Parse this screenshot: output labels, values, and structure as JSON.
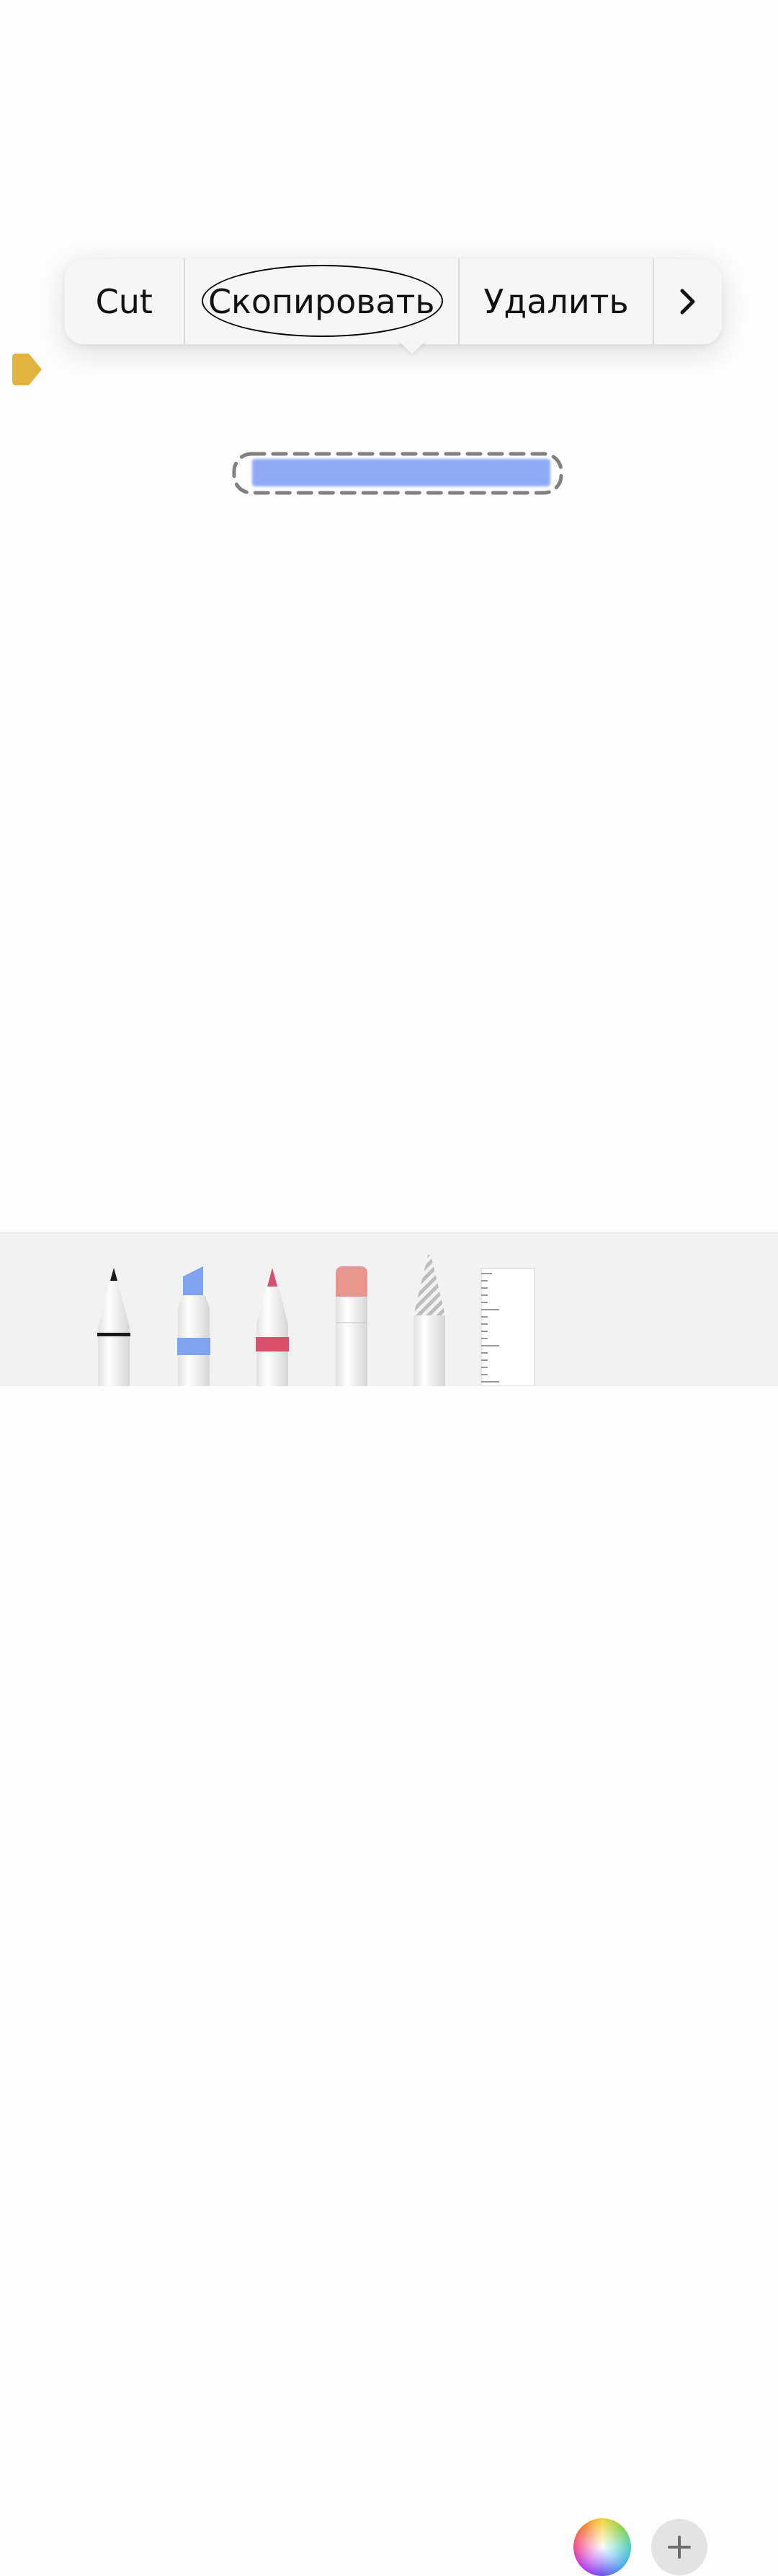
{
  "context_menu": {
    "cut_label": "Cut",
    "copy_label": "Скопировать",
    "delete_label": "Удалить",
    "more_icon": "chevron-right-icon"
  },
  "toolbar": {
    "tools": [
      {
        "name": "pen",
        "icon": "pen-icon",
        "color": "#1a1a1a"
      },
      {
        "name": "marker",
        "icon": "marker-icon",
        "color": "#7fa3ee"
      },
      {
        "name": "pencil",
        "icon": "pencil-icon",
        "color": "#d9506e"
      },
      {
        "name": "eraser",
        "icon": "eraser-icon",
        "color": "#e9958f"
      },
      {
        "name": "lasso",
        "icon": "lasso-icon",
        "color": "#cfcfcf"
      },
      {
        "name": "ruler",
        "icon": "ruler-icon",
        "color": "#ffffff"
      }
    ],
    "color_picker_icon": "color-wheel-icon",
    "add_icon": "plus-icon"
  },
  "canvas": {
    "stroke_color": "#90acf7",
    "side_marker_color": "#e1b43e"
  }
}
